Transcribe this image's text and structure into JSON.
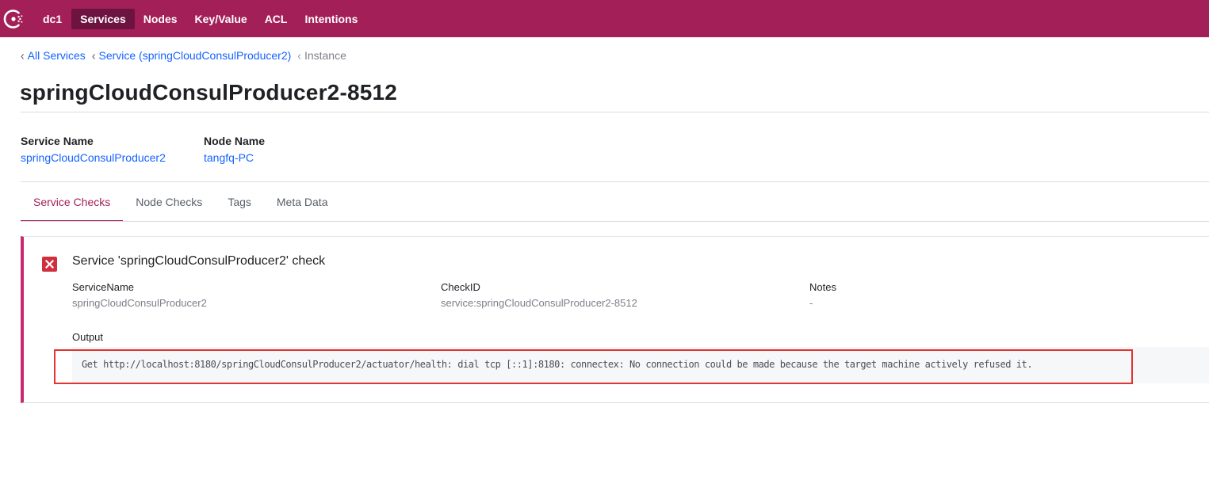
{
  "nav": {
    "datacenter": "dc1",
    "items": [
      {
        "label": "Services",
        "active": true
      },
      {
        "label": "Nodes",
        "active": false
      },
      {
        "label": "Key/Value",
        "active": false
      },
      {
        "label": "ACL",
        "active": false
      },
      {
        "label": "Intentions",
        "active": false
      }
    ]
  },
  "breadcrumb": {
    "items": [
      {
        "label": "All Services"
      },
      {
        "label": "Service (springCloudConsulProducer2)"
      }
    ],
    "current": "Instance"
  },
  "page": {
    "title": "springCloudConsulProducer2-8512"
  },
  "meta": {
    "service_name_label": "Service Name",
    "service_name_value": "springCloudConsulProducer2",
    "node_name_label": "Node Name",
    "node_name_value": "tangfq-PC"
  },
  "tabs": [
    {
      "label": "Service Checks",
      "active": true
    },
    {
      "label": "Node Checks",
      "active": false
    },
    {
      "label": "Tags",
      "active": false
    },
    {
      "label": "Meta Data",
      "active": false
    }
  ],
  "check": {
    "status": "critical",
    "title": "Service 'springCloudConsulProducer2' check",
    "service_name_label": "ServiceName",
    "service_name_value": "springCloudConsulProducer2",
    "check_id_label": "CheckID",
    "check_id_value": "service:springCloudConsulProducer2-8512",
    "notes_label": "Notes",
    "notes_value": "-",
    "output_label": "Output",
    "output_value": "Get http://localhost:8180/springCloudConsulProducer2/actuator/health: dial tcp [::1]:8180: connectex: No connection could be made because the target machine actively refused it."
  },
  "colors": {
    "brand": "#a31f58",
    "brand_active": "#6d1340",
    "link": "#1563ff",
    "critical": "#d0303e",
    "annotation_box": "#e33333"
  },
  "icons": {
    "logo": "consul-logo",
    "breadcrumb_separator": "chevron-left-icon",
    "check_status": "critical-x-icon"
  }
}
